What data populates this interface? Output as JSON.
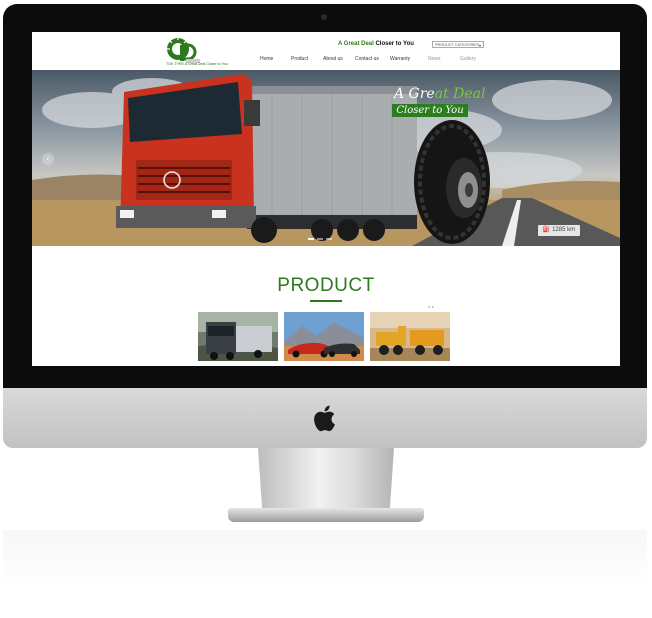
{
  "brand": {
    "logo_text": "TGK TYRE  A Great Deal Closer to You"
  },
  "header": {
    "tagline_green": "A Great Deal ",
    "tagline_black": "Closer to You",
    "category_select": "PRODUCT CATEGORIES"
  },
  "nav": [
    "Home",
    "Product",
    "About us",
    "Contact us",
    "Warranty",
    "News",
    "Gallery"
  ],
  "hero": {
    "title_white": "A Gre",
    "title_green": "at Deal",
    "subtitle": "Closer to You",
    "km_badge": "1285 km",
    "prev_arrow": "‹"
  },
  "product": {
    "title": "PRODUCT",
    "pager": "● ●",
    "thumbnails": [
      "truck",
      "sports-cars",
      "mining-trucks"
    ]
  },
  "colors": {
    "brand_green": "#2d7a1c",
    "truck_red": "#c8321e",
    "bezel": "#0c0c0c"
  },
  "icons": [
    "apple-logo-icon",
    "camera-icon",
    "chevron-left-icon",
    "fuel-icon"
  ]
}
